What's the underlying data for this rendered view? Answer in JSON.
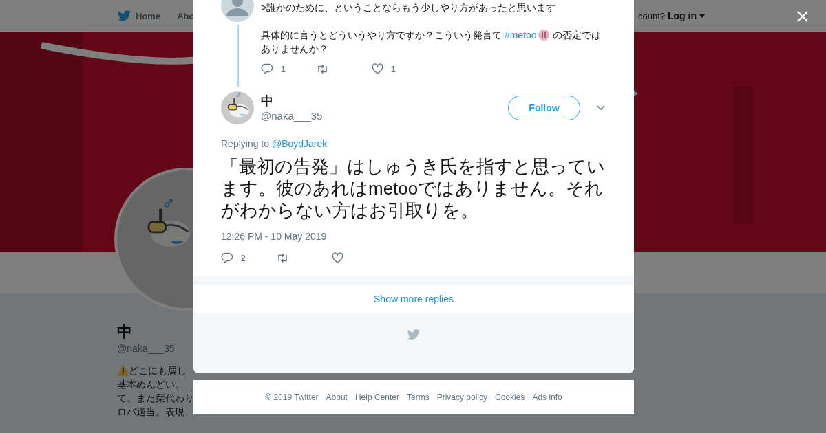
{
  "background_page": {
    "nav": [
      {
        "label": "Home",
        "kind": "home"
      },
      {
        "label": "Abo",
        "kind": "plain"
      }
    ],
    "login_prompt": "count?",
    "login_link": "Log in",
    "profile": {
      "name": "中",
      "handle": "@naka___35",
      "bio_lines": [
        "⚠️どこにも属し",
        "基本めんどい。",
        "て。また栞代わり",
        "ロバ適当。表現"
      ]
    }
  },
  "modal": {
    "parent_tweet": {
      "lines": [
        [
          {
            "kind": "text",
            "text": ">誰かのために、ということならもう少しやり方があったと思います"
          }
        ],
        [
          {
            "kind": "text",
            "text": "具体的に言うとどういうやり方ですか？こういう発言て "
          },
          {
            "kind": "hashtag",
            "text": "#metoo"
          },
          {
            "kind": "emoji"
          },
          {
            "kind": "text",
            "text": " の否定ではありませんか？"
          }
        ]
      ],
      "actions": [
        {
          "kind": "reply",
          "count": "1"
        },
        {
          "kind": "retweet"
        },
        {
          "kind": "like",
          "count": "1"
        }
      ]
    },
    "tweet": {
      "name": "中",
      "handle": "@naka___35",
      "follow_label": "Follow",
      "replying_prefix": "Replying to",
      "reply_to": "@BoydJarek",
      "text": "「最初の告発」はしゅうき氏を指すと思っています。彼のあれはmetooではありません。それがわからない方はお引取りを。",
      "timestamp": "12:26 PM - 10 May 2019",
      "actions": [
        {
          "kind": "reply",
          "count": "2"
        },
        {
          "kind": "retweet"
        },
        {
          "kind": "like"
        }
      ]
    },
    "show_more": "Show more replies"
  },
  "footer": [
    "© 2019 Twitter",
    "About",
    "Help Center",
    "Terms",
    "Privacy policy",
    "Cookies",
    "Ads info"
  ]
}
